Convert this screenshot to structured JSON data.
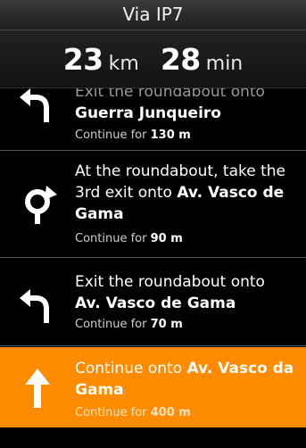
{
  "header": {
    "title": "Via IP7"
  },
  "summary": {
    "distance_value": "23",
    "distance_unit": "km",
    "time_value": "28",
    "time_unit": "min"
  },
  "steps": [
    {
      "icon": "roundabout-exit-left-icon",
      "instruction_prefix": "Exit the roundabout onto",
      "street": "Guerra Junqueiro",
      "continue_label": "Continue for",
      "continue_value": "130 m"
    },
    {
      "icon": "roundabout-icon",
      "instruction_prefix": "At the roundabout, take the 3rd exit onto",
      "street": "Av. Vasco de Gama",
      "continue_label": "Continue for",
      "continue_value": "90 m"
    },
    {
      "icon": "roundabout-exit-left-icon",
      "instruction_prefix": "Exit the roundabout onto",
      "street": "Av. Vasco de Gama",
      "continue_label": "Continue for",
      "continue_value": "70 m"
    },
    {
      "icon": "straight-arrow-icon",
      "instruction_prefix": "Continue onto",
      "street": "Av. Vasco da Gama",
      "continue_label": "Continue for",
      "continue_value": "400 m"
    }
  ],
  "colors": {
    "active": "#ff8c00",
    "background": "#000000"
  }
}
